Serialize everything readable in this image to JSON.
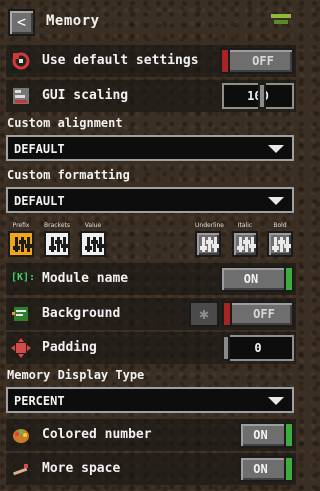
{
  "header": {
    "title": "Memory",
    "back_glyph": "<"
  },
  "rows": {
    "use_default": {
      "label": "Use default settings",
      "toggle": "OFF",
      "icon": "reset-icon"
    },
    "gui_scaling": {
      "label": "GUI scaling",
      "value": "100",
      "icon": "scaling-icon"
    },
    "module_name": {
      "label": "Module name",
      "toggle": "ON",
      "icon_text": "[K]:"
    },
    "background": {
      "label": "Background",
      "toggle": "OFF",
      "icon": "background-icon",
      "settings_icon": "gear-icon"
    },
    "padding": {
      "label": "Padding",
      "value": "0",
      "icon": "padding-icon"
    },
    "colored_number": {
      "label": "Colored number",
      "toggle": "ON",
      "icon": "palette-icon"
    },
    "more_space": {
      "label": "More space",
      "toggle": "ON",
      "icon": "space-icon"
    }
  },
  "sections": {
    "custom_alignment": {
      "label": "Custom alignment",
      "value": "DEFAULT"
    },
    "custom_formatting": {
      "label": "Custom formatting",
      "value": "DEFAULT"
    },
    "display_type": {
      "label": "Memory Display Type",
      "value": "PERCENT"
    }
  },
  "format_buttons": [
    {
      "label": "Prefix",
      "state": "active-orange"
    },
    {
      "label": "Brackets",
      "state": "active-white"
    },
    {
      "label": "Value",
      "state": "active-white"
    },
    {
      "label": "Underline",
      "state": "inactive"
    },
    {
      "label": "Italic",
      "state": "inactive"
    },
    {
      "label": "Bold",
      "state": "inactive"
    }
  ],
  "colors": {
    "toggle_on": "#3cad3c",
    "toggle_off": "#a82424",
    "accent_orange": "#f2a51a"
  }
}
